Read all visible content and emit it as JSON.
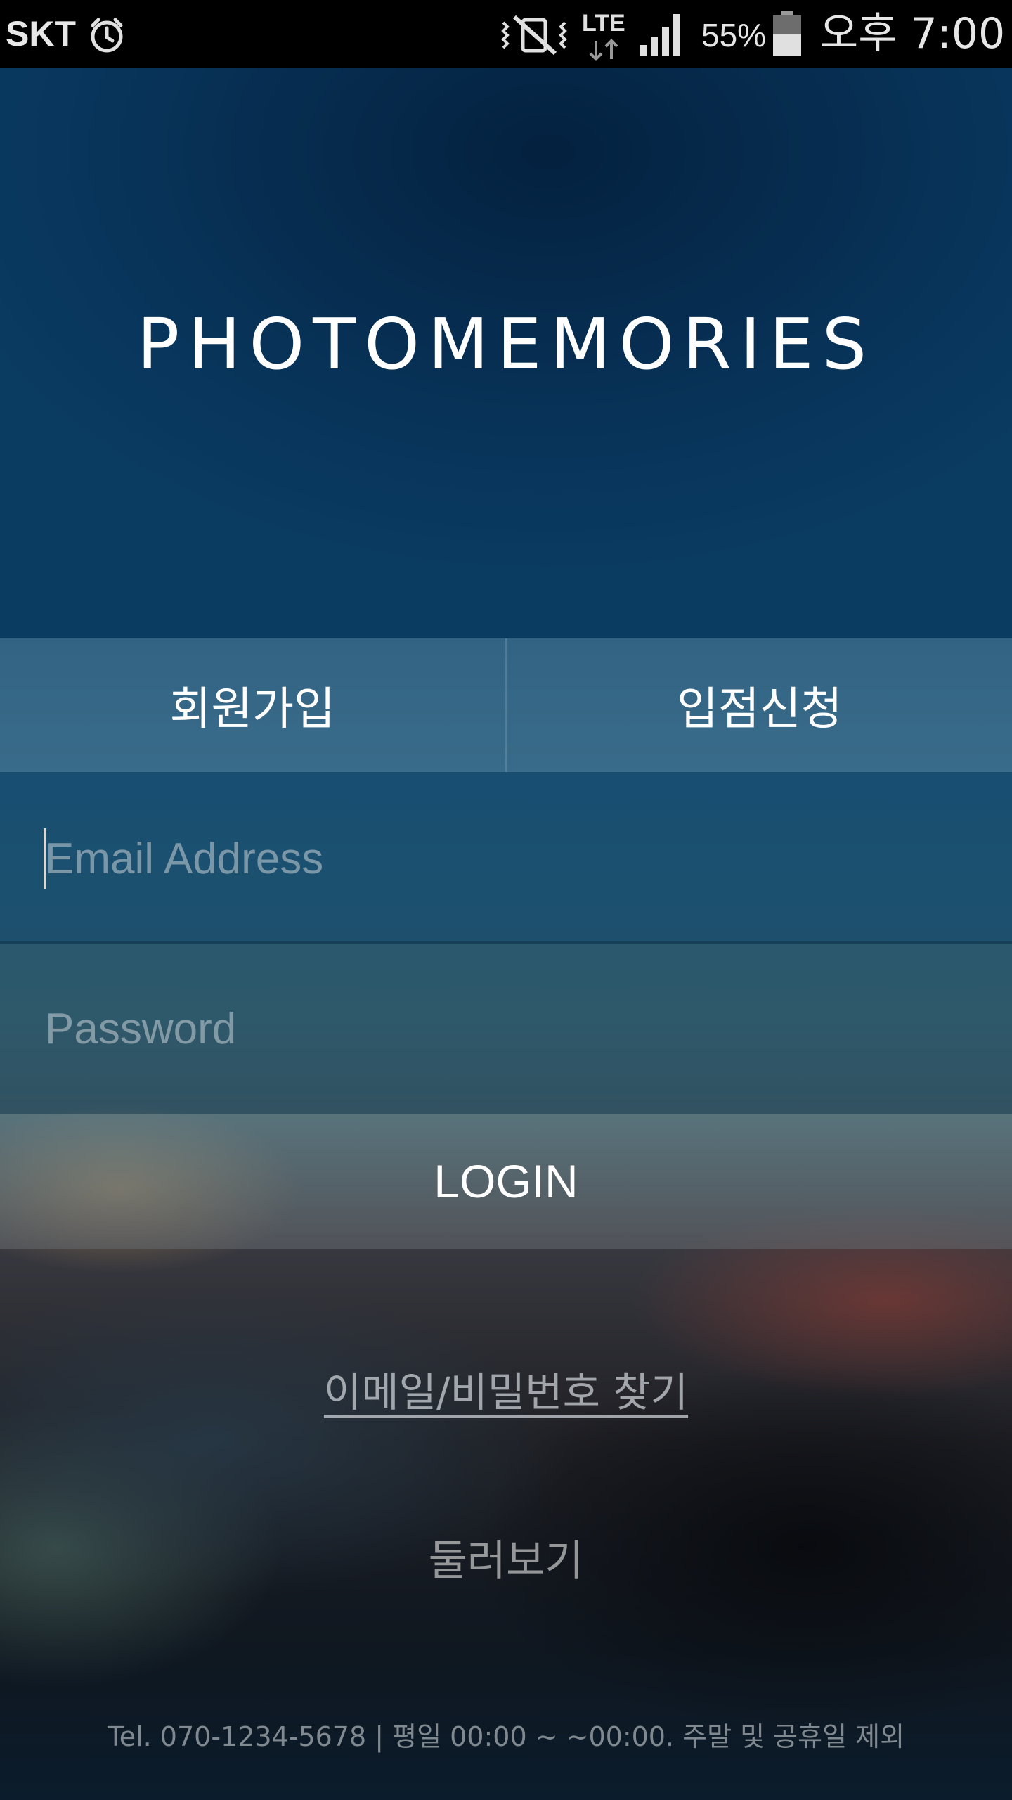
{
  "status_bar": {
    "carrier": "SKT",
    "alarm_icon": "alarm-clock-icon",
    "mute_icon": "vibrate-off-icon",
    "network_label": "LTE",
    "signal_icon": "signal-strength-icon",
    "battery_percent": "55%",
    "battery_icon": "battery-icon",
    "battery_level": 0.55,
    "time": "오후 7:00"
  },
  "logo": {
    "text": "PHOTOMEMORIES"
  },
  "tabs": [
    {
      "label": "회원가입"
    },
    {
      "label": "입점신청"
    }
  ],
  "form": {
    "email_placeholder": "Email Address",
    "email_value": "",
    "password_placeholder": "Password",
    "password_value": "",
    "login_label": "LOGIN"
  },
  "links": {
    "find_account": "이메일/비밀번호 찾기",
    "browse": "둘러보기"
  },
  "footer": {
    "info": "Tel. 070-1234-5678 | 평일 00:00 ~ ~00:00. 주말 및 공휴일 제외"
  },
  "colors": {
    "status_bar_bg": "#000000",
    "header_bg": "#08345a",
    "text": "#ffffff"
  }
}
